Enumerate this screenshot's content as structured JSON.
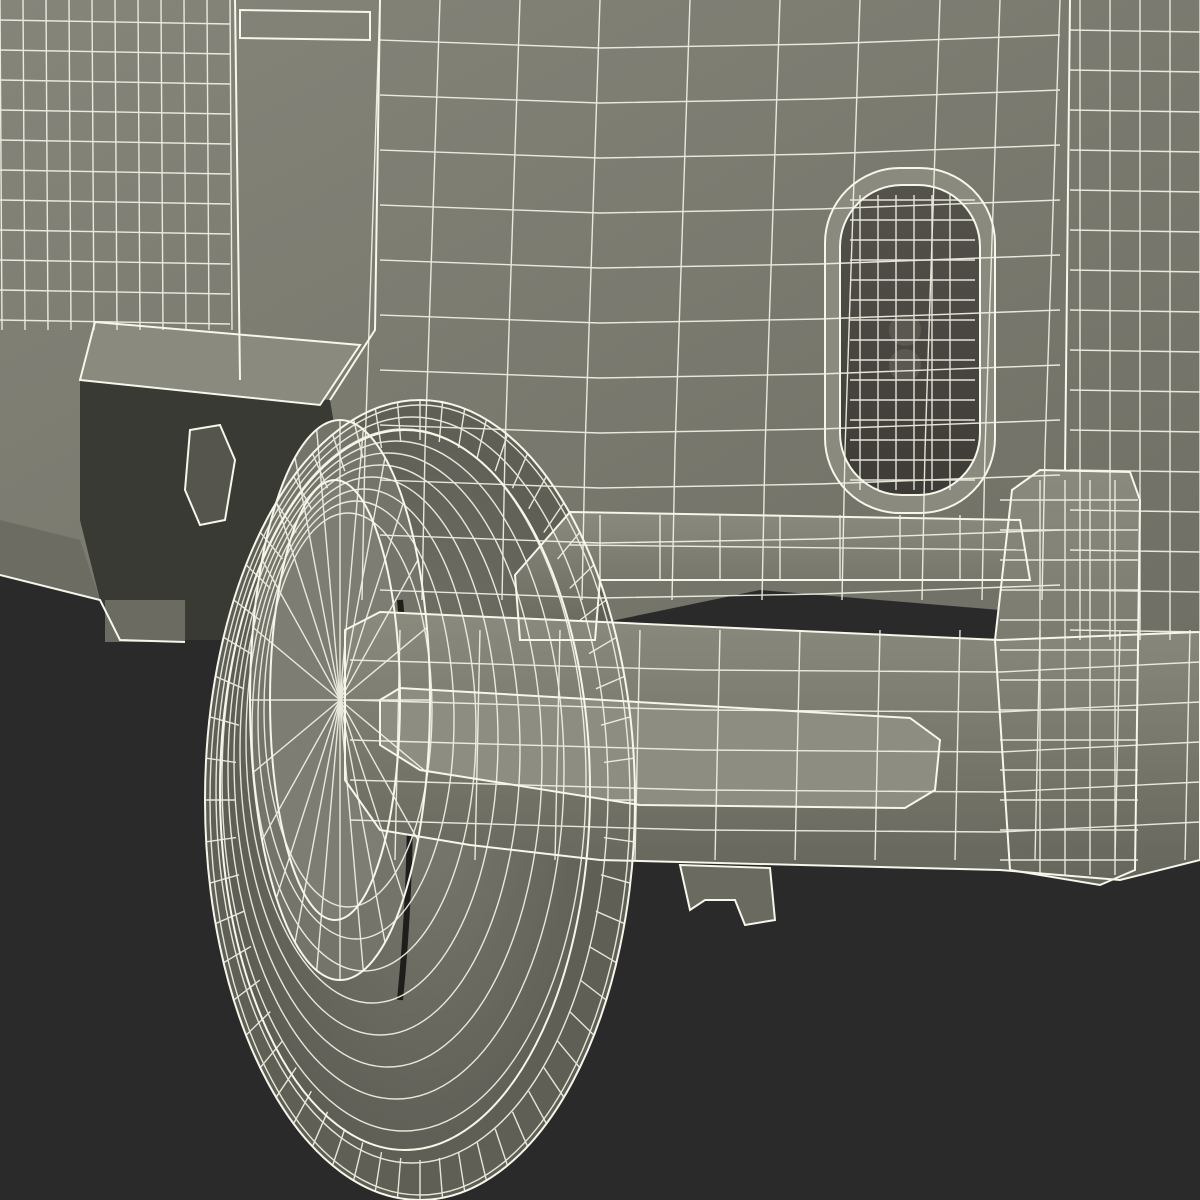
{
  "scene": {
    "subject": "wireframe-3d-vehicle-rear-corner",
    "colors": {
      "background": "#2a2a2a",
      "body_surface": "#7d7d71",
      "body_shadow": "#5f5f55",
      "wire": "#f2f2e6",
      "tail_lens": "#4a4742",
      "tire": "#6e6e64",
      "wheel_well": "#3a3a35"
    },
    "icons": []
  }
}
